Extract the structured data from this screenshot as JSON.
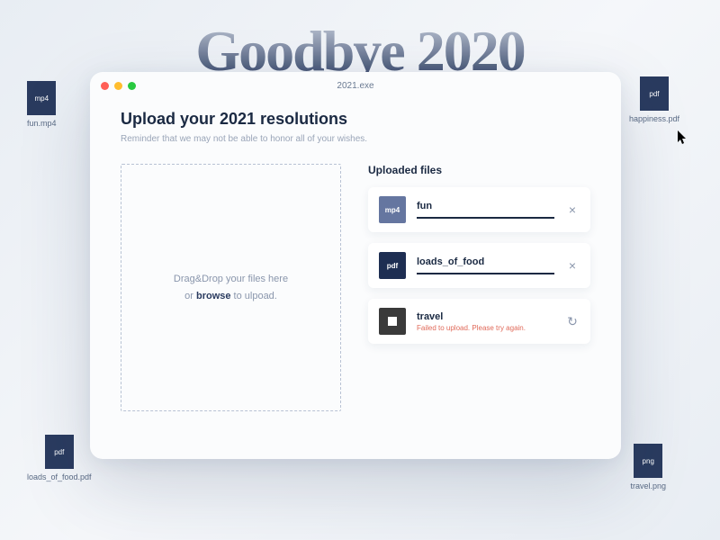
{
  "bg_title": "Goodbye 2020",
  "desktop": [
    {
      "ext": "mp4",
      "name": "fun.mp4"
    },
    {
      "ext": "pdf",
      "name": "happiness.pdf"
    },
    {
      "ext": "pdf",
      "name": "loads_of_food.pdf"
    },
    {
      "ext": "png",
      "name": "travel.png"
    }
  ],
  "window": {
    "title": "2021.exe",
    "heading": "Upload your 2021 resolutions",
    "subheading": "Reminder that we may not be able to honor all of your wishes.",
    "dropzone_line1": "Drag&Drop your files here",
    "dropzone_or": "or ",
    "dropzone_browse": "browse",
    "dropzone_tail": " to ulpoad.",
    "files_heading": "Uploaded files",
    "files": [
      {
        "ext": "mp4",
        "name": "fun",
        "status": "ok",
        "action": "×"
      },
      {
        "ext": "pdf",
        "name": "loads_of_food",
        "status": "ok",
        "action": "×"
      },
      {
        "ext": "err",
        "name": "travel",
        "status": "error",
        "error": "Failed to upload. Please try again.",
        "action": "↻"
      }
    ]
  }
}
